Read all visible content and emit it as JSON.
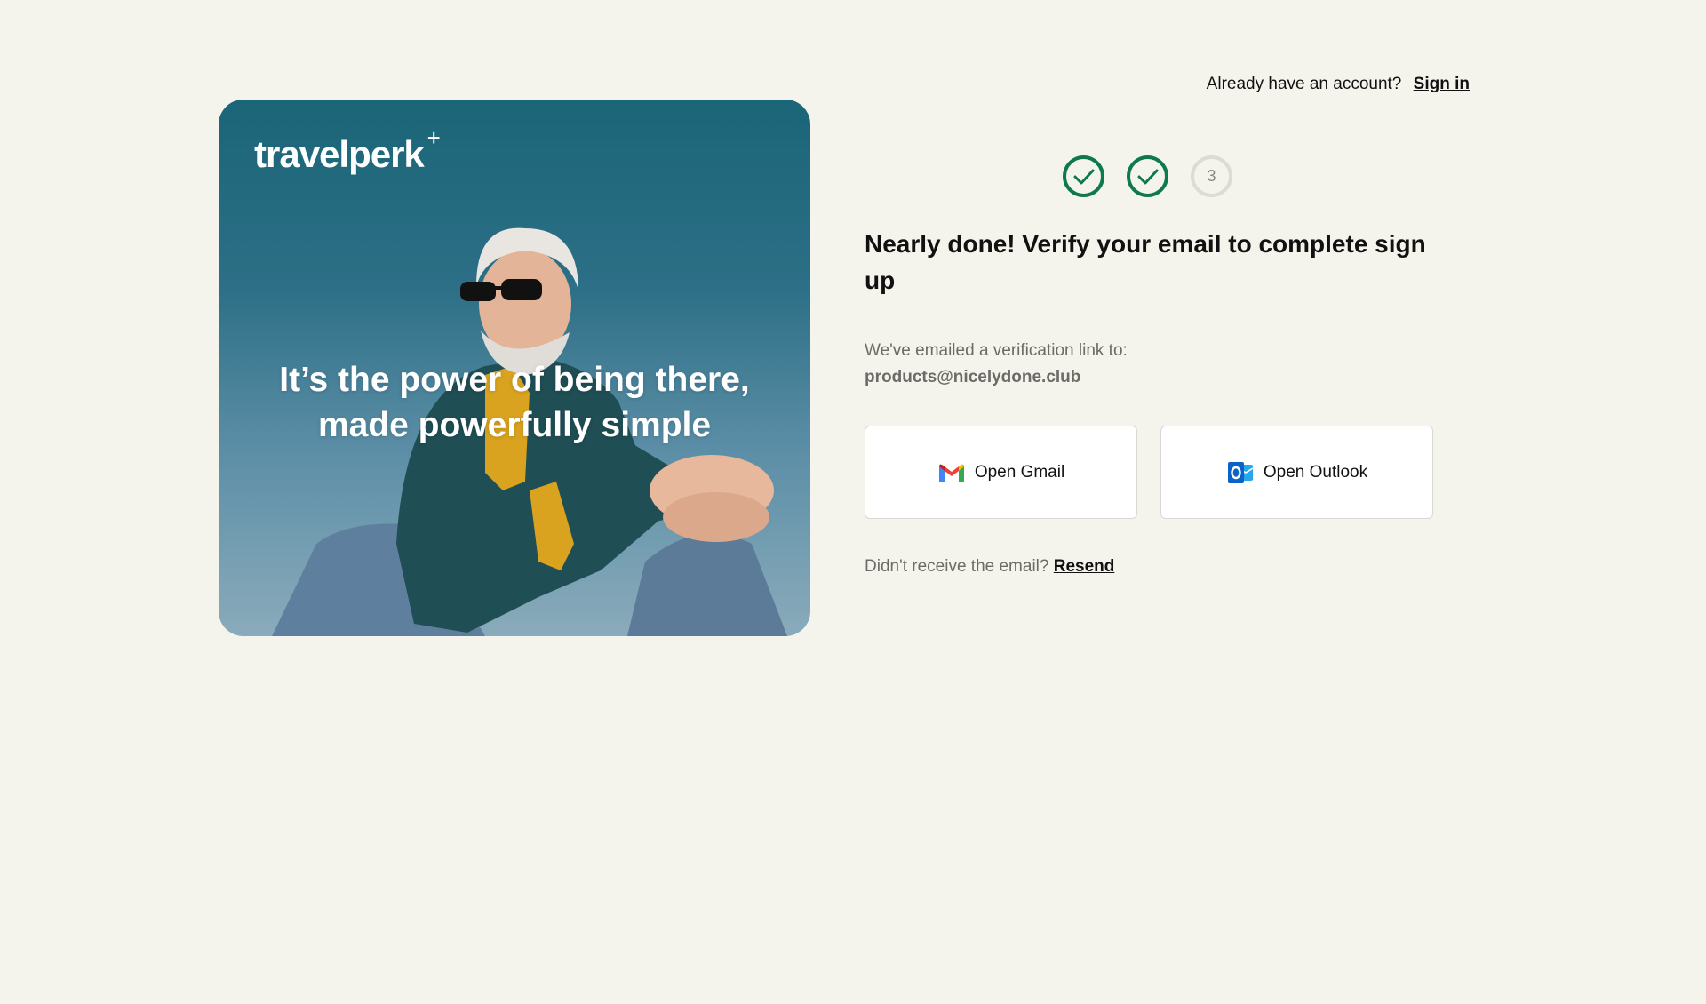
{
  "hero": {
    "logo_text": "travelperk",
    "logo_plus": "+",
    "tagline_line1": "It’s the power of being there,",
    "tagline_line2": "made powerfully simple"
  },
  "header": {
    "account_prompt": "Already have an account?",
    "sign_in_label": "Sign in"
  },
  "steps": [
    {
      "state": "done",
      "icon": "check-icon"
    },
    {
      "state": "done",
      "icon": "check-icon"
    },
    {
      "state": "pending",
      "label": "3"
    }
  ],
  "main": {
    "headline": "Nearly done! Verify your email to complete sign up",
    "sent_text": "We've emailed a verification link to:",
    "email": "products@nicelydone.club",
    "gmail_label": "Open Gmail",
    "outlook_label": "Open Outlook",
    "resend_prompt": "Didn't receive the email?",
    "resend_label": "Resend"
  },
  "colors": {
    "background": "#f5f4ec",
    "accent_green": "#0e7a4b",
    "hero_blue": "#1b6578"
  }
}
